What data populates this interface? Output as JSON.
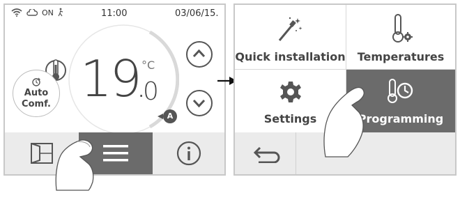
{
  "left_screen": {
    "status": {
      "on_label": "ON",
      "time": "11:00",
      "date": "03/06/15."
    },
    "temperature": {
      "integer": "19",
      "decimal": "0",
      "unit": "°C"
    },
    "mode": {
      "line1": "Auto",
      "line2": "Comf."
    },
    "badge": "A",
    "bottom_bar": {
      "icons": [
        "window-icon",
        "menu-icon",
        "info-icon"
      ]
    }
  },
  "right_screen": {
    "tiles": [
      {
        "label": "Quick installation",
        "icon": "magic-wand-icon"
      },
      {
        "label": "Temperatures",
        "icon": "thermometer-gear-icon"
      },
      {
        "label": "Settings",
        "icon": "gear-icon"
      },
      {
        "label": "Programming",
        "icon": "thermometer-clock-icon",
        "selected": true
      }
    ],
    "bottom_bar": {
      "icons": [
        "back-icon"
      ]
    }
  },
  "colors": {
    "selected_tile": "#6b6b6b",
    "bar": "#ebebeb",
    "frame": "#c8c8c8"
  }
}
